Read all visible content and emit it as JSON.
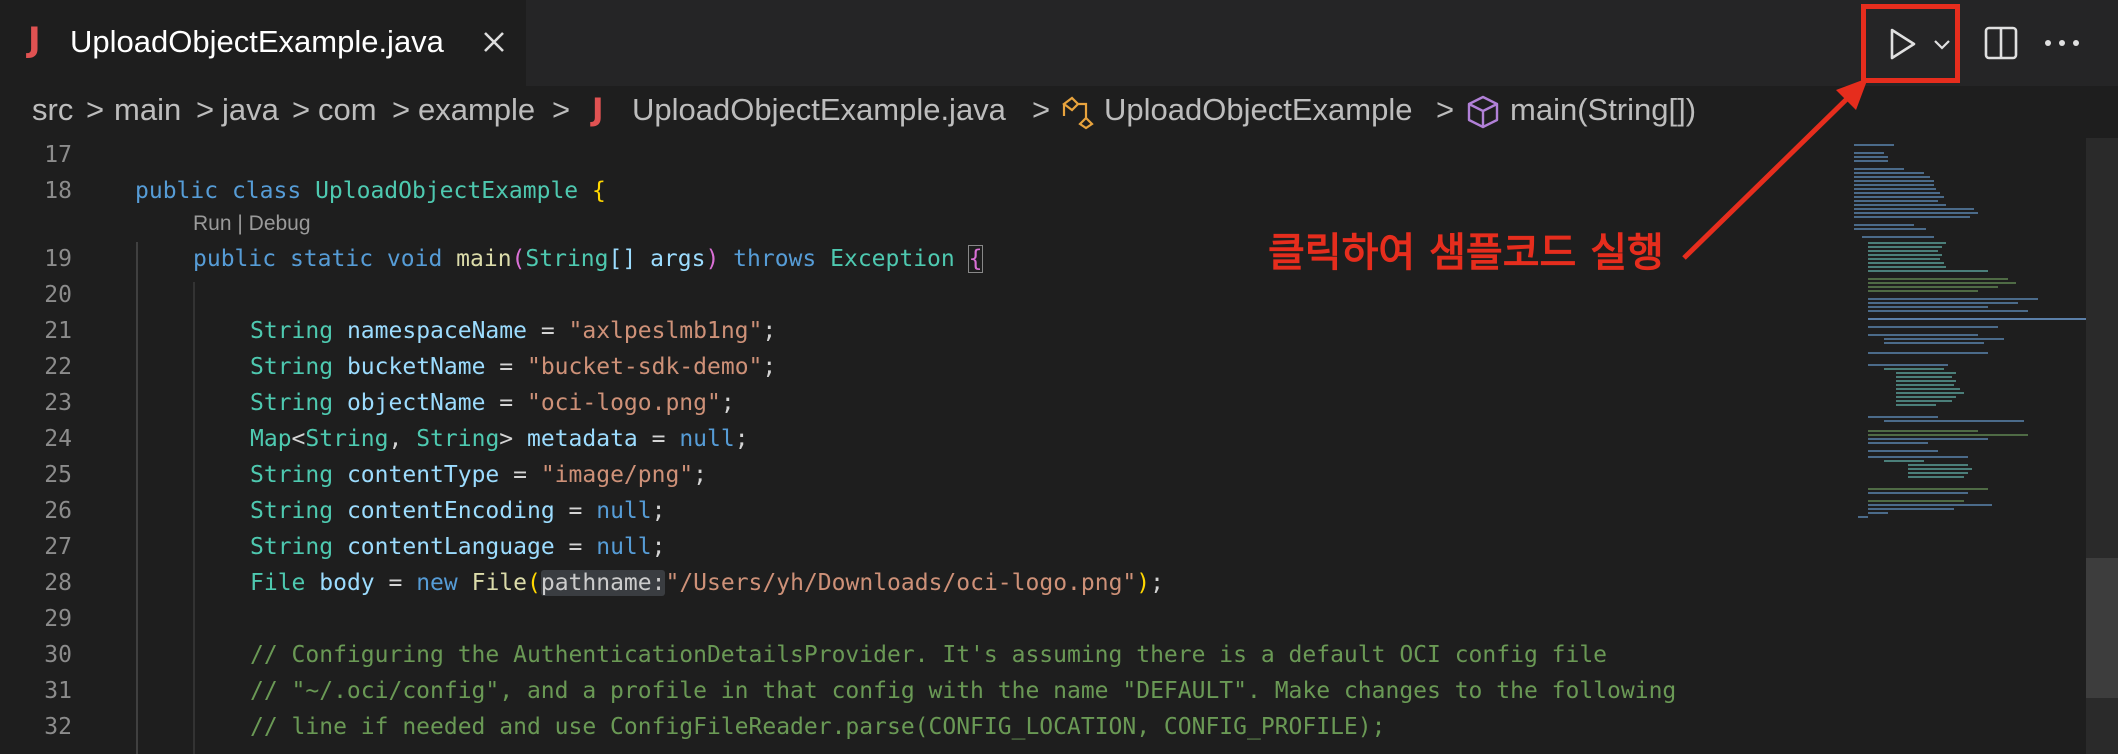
{
  "tab": {
    "file_type_letter": "J",
    "title": "UploadObjectExample.java"
  },
  "toolbar_icons": [
    "run-icon",
    "chevron-down-icon",
    "split-editor-icon",
    "more-icon"
  ],
  "breadcrumb": {
    "items": [
      "src",
      "main",
      "java",
      "com",
      "example",
      "UploadObjectExample.java",
      "UploadObjectExample",
      "main(String[])"
    ],
    "file_icon_letter": "J",
    "separator": ">"
  },
  "code_lens": "Run | Debug",
  "line_numbers": [
    "17",
    "18",
    "19",
    "20",
    "21",
    "22",
    "23",
    "24",
    "25",
    "26",
    "27",
    "28",
    "29",
    "30",
    "31",
    "32"
  ],
  "code": {
    "l18": {
      "kw1": "public",
      "kw2": "class",
      "name": "UploadObjectExample",
      "brace": "{"
    },
    "l19": {
      "kw1": "public",
      "kw2": "static",
      "kw3": "void",
      "fn": "main",
      "p1": "(",
      "ty": "String",
      "arr": "[]",
      "arg": "args",
      "p2": ")",
      "throws": "throws",
      "exc": "Exception",
      "brace": "{"
    },
    "l21": {
      "ty": "String",
      "var": "namespaceName",
      "op": " = ",
      "val": "\"axlpeslmb1ng\"",
      "end": ";"
    },
    "l22": {
      "ty": "String",
      "var": "bucketName",
      "op": " = ",
      "val": "\"bucket-sdk-demo\"",
      "end": ";"
    },
    "l23": {
      "ty": "String",
      "var": "objectName",
      "op": " = ",
      "val": "\"oci-logo.png\"",
      "end": ";"
    },
    "l24": {
      "ty1": "Map",
      "lt": "<",
      "ty2": "String",
      "comma": ", ",
      "ty3": "String",
      "gt": "> ",
      "var": "metadata",
      "op": " = ",
      "val": "null",
      "end": ";"
    },
    "l25": {
      "ty": "String",
      "var": "contentType",
      "op": " = ",
      "val": "\"image/png\"",
      "end": ";"
    },
    "l26": {
      "ty": "String",
      "var": "contentEncoding",
      "op": " = ",
      "val": "null",
      "end": ";"
    },
    "l27": {
      "ty": "String",
      "var": "contentLanguage",
      "op": " = ",
      "val": "null",
      "end": ";"
    },
    "l28": {
      "ty": "File",
      "var": "body",
      "op": " = ",
      "kw": "new",
      "ctor": "File",
      "p1": "(",
      "hint": "pathname:",
      "val": "\"/Users/yh/Downloads/oci-logo.png\"",
      "p2": ")",
      "end": ";"
    },
    "l30": "// Configuring the AuthenticationDetailsProvider. It's assuming there is a default OCI config file",
    "l31": "// \"~/.oci/config\", and a profile in that config with the name \"DEFAULT\". Make changes to the following",
    "l32": "// line if needed and use ConfigFileReader.parse(CONFIG_LOCATION, CONFIG_PROFILE);"
  },
  "annotation": "클릭하여 샘플코드 실행",
  "colors": {
    "annotation": "#e62d1d",
    "keyword": "#569cd6",
    "type": "#4ec9b0",
    "string": "#ce9178",
    "comment": "#6a9955",
    "java_icon": "#e05252"
  }
}
